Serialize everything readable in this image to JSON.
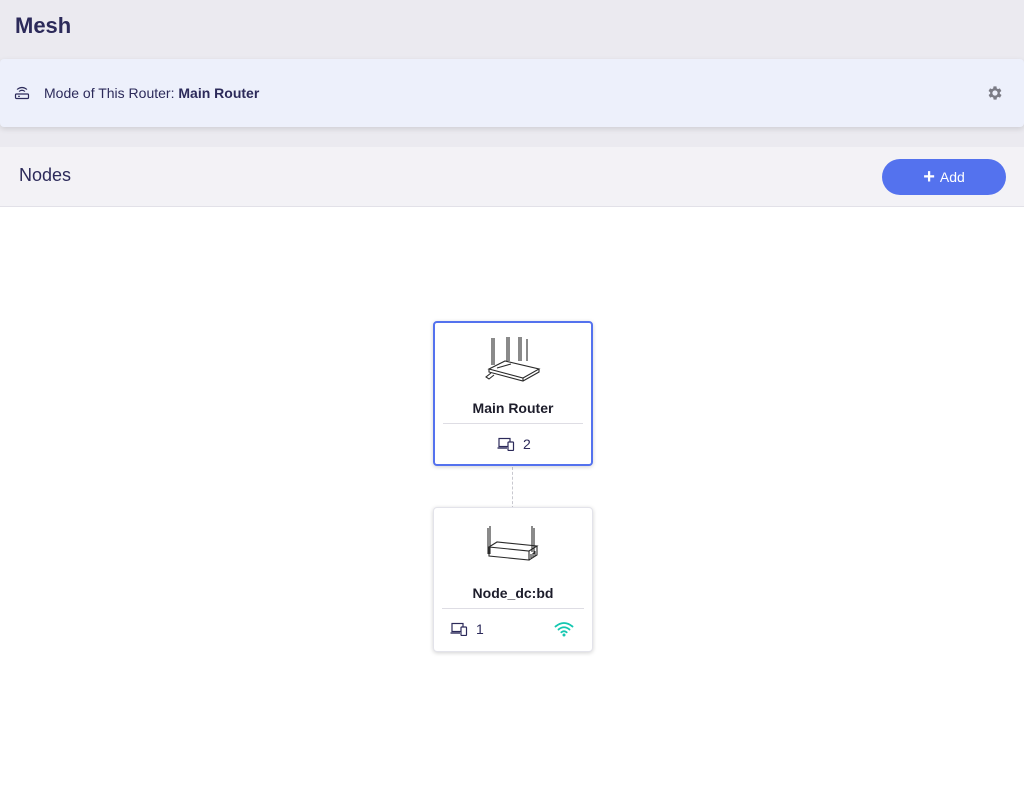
{
  "page": {
    "title": "Mesh"
  },
  "mode_bar": {
    "label": "Mode of This Router:",
    "value": "Main Router",
    "icon": "router-icon",
    "settings_icon": "gear-icon"
  },
  "nodes_section": {
    "title": "Nodes",
    "add_label": "Add"
  },
  "nodes": [
    {
      "name": "Main Router",
      "clients": "2",
      "role": "main"
    },
    {
      "name": "Node_dc:bd",
      "clients": "1",
      "role": "satellite",
      "link": "wifi-icon"
    }
  ],
  "colors": {
    "accent": "#5472ee",
    "title": "#2c2a5a",
    "wifi": "#14c7b0"
  }
}
